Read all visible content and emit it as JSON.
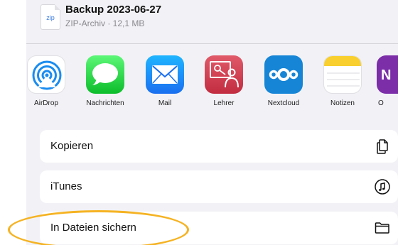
{
  "file": {
    "ext": "zip",
    "name": "Backup 2023-06-27",
    "meta": "ZIP-Archiv · 12,1 MB"
  },
  "apps": [
    {
      "label": "AirDrop",
      "icon": "airdrop-icon"
    },
    {
      "label": "Nachrichten",
      "icon": "messages-icon"
    },
    {
      "label": "Mail",
      "icon": "mail-icon"
    },
    {
      "label": "Lehrer",
      "icon": "teacher-icon"
    },
    {
      "label": "Nextcloud",
      "icon": "nextcloud-icon"
    },
    {
      "label": "Notizen",
      "icon": "notes-icon"
    },
    {
      "label": "O",
      "icon": "onenote-icon"
    }
  ],
  "actions": [
    {
      "label": "Kopieren",
      "icon": "copy-icon"
    },
    {
      "label": "iTunes",
      "icon": "music-icon"
    },
    {
      "label": "In Dateien sichern",
      "icon": "folder-icon"
    }
  ],
  "colors": {
    "highlight": "#f5b323",
    "background": "#f2f2f6"
  }
}
